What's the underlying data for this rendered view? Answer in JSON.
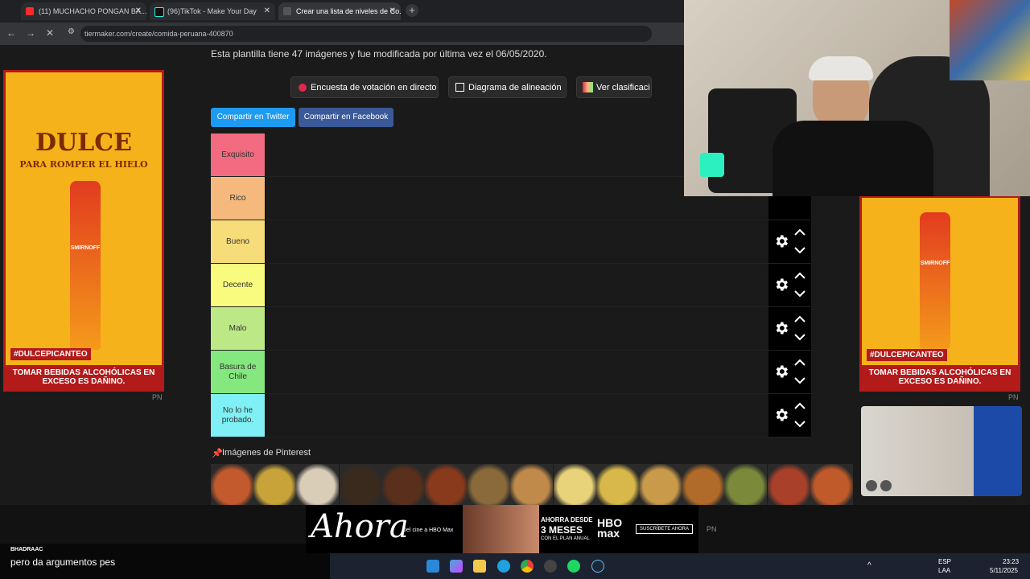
{
  "tabs": [
    {
      "title": "(11) MUCHACHO PONGAN BA..."
    },
    {
      "title": "(96)TikTok - Make Your Day"
    },
    {
      "title": "Crear una lista de niveles de Co..."
    }
  ],
  "address": {
    "url": "tiermaker.com/create/comida-peruana-400870"
  },
  "info_text": "Esta plantilla tiene 47 imágenes y fue modificada por última vez el 06/05/2020.",
  "buttons": {
    "live_vote": "Encuesta de votación en directo",
    "alignment": "Diagrama de alineación",
    "view_rankings": "Ver clasificaci",
    "share_twitter": "Compartir en Twitter",
    "share_facebook": "Compartir en Facebook"
  },
  "tiers": [
    {
      "label": "Exquisito",
      "color": "#f26b80"
    },
    {
      "label": "Rico",
      "color": "#f5b97d"
    },
    {
      "label": "Bueno",
      "color": "#f7dd7a"
    },
    {
      "label": "Decente",
      "color": "#f8fb7e"
    },
    {
      "label": "Malo",
      "color": "#bde886"
    },
    {
      "label": "Basura de Chile",
      "color": "#84e87e"
    },
    {
      "label": "No lo he probado.",
      "color": "#7ff0f5"
    }
  ],
  "pinterest_label": "Imágenes de Pinterest",
  "food_colors": [
    "#c25a2e",
    "#c8a33a",
    "#d9cdb8",
    "#3a2a1e",
    "#5a2f1c",
    "#8a3a1c",
    "#8a6a3a",
    "#c08a4a",
    "#e8d27a",
    "#d8b84a",
    "#c89a4a",
    "#b06a2a",
    "#7a8a3a",
    "#a8402a",
    "#c05a2a"
  ],
  "ads": {
    "left_headline": "DULCE",
    "left_sub": "PARA ROMPER EL HIELO",
    "brand": "SMIRNOFF",
    "hashtag": "#DULCEPICANTEO",
    "warning": "TOMAR BEBIDAS ALCOHÓLICAS EN EXCESO ES DAÑINO.",
    "pn": "PN"
  },
  "bottom_ad": {
    "script": "Ahora",
    "line1": "Del cine a HBO Max",
    "offer": "AHORRA DESDE",
    "offer_big": "3 MESES",
    "offer_small": "CON EL PLAN ANUAL",
    "brand": "HBO max",
    "cta": "SUSCRÍBETE AHORA"
  },
  "chat": {
    "user": "BHADRAAC",
    "message": "pero da argumentos pes"
  },
  "tray": {
    "lang1": "ESP",
    "lang2": "LAA",
    "time": "23:23",
    "date": "5/11/2025"
  }
}
